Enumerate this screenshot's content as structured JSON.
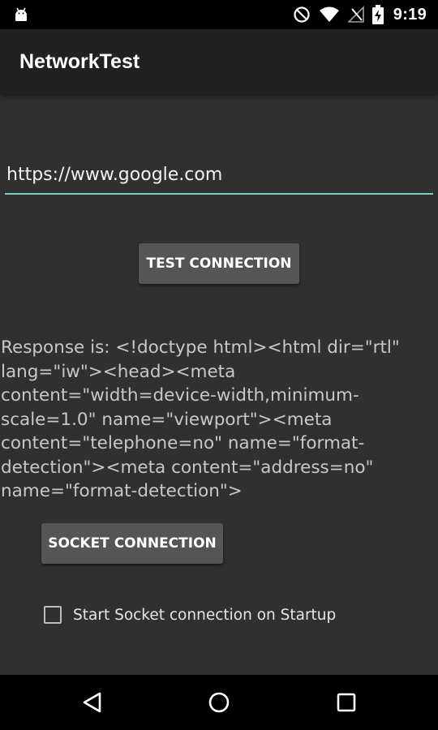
{
  "status_bar": {
    "time": "9:19",
    "battery_level_percent": 60,
    "icons": [
      "android-debug-icon",
      "do-not-disturb-icon",
      "wifi-icon",
      "cell-signal-no-service-icon",
      "battery-charging-icon"
    ]
  },
  "app_bar": {
    "title": "NetworkTest"
  },
  "url_input": {
    "value": "https://www.google.com"
  },
  "buttons": {
    "test_connection": "TEST CONNECTION",
    "socket_connection": "SOCKET CONNECTION"
  },
  "response": {
    "text": "Response is: <!doctype html><html dir=\"rtl\" lang=\"iw\"><head><meta content=\"width=device-width,minimum-scale=1.0\" name=\"viewport\"><meta content=\"telephone=no\" name=\"format-detection\"><meta content=\"address=no\" name=\"format-detection\">"
  },
  "checkbox": {
    "label": "Start Socket connection on Startup",
    "checked": false
  },
  "nav_bar": {
    "icons": [
      "back-icon",
      "home-icon",
      "recents-icon"
    ]
  },
  "colors": {
    "background": "#303030",
    "app_bar": "#212121",
    "accent_underline": "#80cbc4",
    "button": "#555555",
    "system_bars": "#000000"
  }
}
